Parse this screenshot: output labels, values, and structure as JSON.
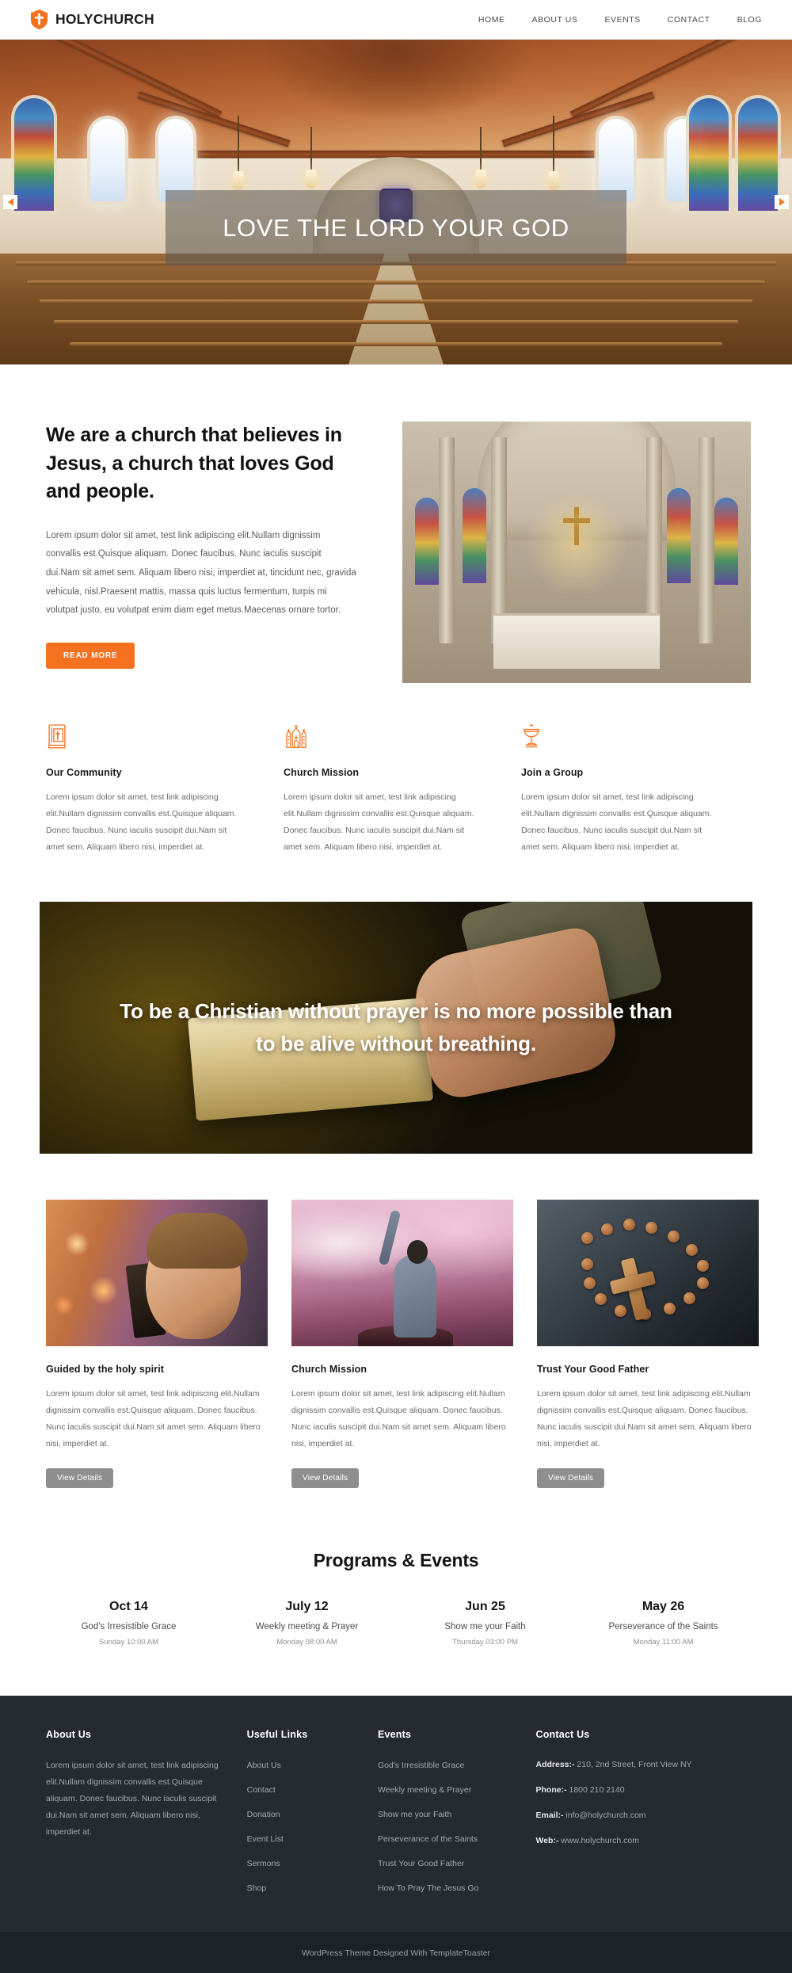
{
  "header": {
    "brand_name": "HOLYCHURCH",
    "logo_icon": "shield-cross-icon",
    "nav": [
      {
        "label": "HOME"
      },
      {
        "label": "ABOUT US"
      },
      {
        "label": "EVENTS"
      },
      {
        "label": "CONTACT"
      },
      {
        "label": "BLOG"
      }
    ]
  },
  "hero": {
    "headline": "LOVE THE LORD YOUR GOD",
    "prev_icon": "arrow-left-icon",
    "next_icon": "arrow-right-icon"
  },
  "about": {
    "heading": "We are a church that believes in Jesus, a church that loves God and people.",
    "body": "Lorem ipsum dolor sit amet, test link adipiscing elit.Nullam dignissim convallis est.Quisque aliquam. Donec faucibus. Nunc iaculis suscipit dui.Nam sit amet sem. Aliquam libero nisi, imperdiet at, tincidunt nec, gravida vehicula, nisl.Praesent mattis, massa quis luctus fermentum, turpis mi volutpat justo, eu volutpat enim diam eget metus.Maecenas ornare tortor.",
    "button_label": "READ MORE",
    "image_alt": "cathedral-interior-with-altar"
  },
  "features": [
    {
      "icon": "bible-cross-icon",
      "title": "Our Community",
      "text": "Lorem ipsum dolor sit amet, test link adipiscing elit.Nullam dignissim convallis est.Quisque aliquam. Donec faucibus. Nunc iaculis suscipit dui.Nam sit amet sem. Aliquam libero nisi, imperdiet at."
    },
    {
      "icon": "church-building-icon",
      "title": "Church Mission",
      "text": "Lorem ipsum dolor sit amet, test link adipiscing elit.Nullam dignissim convallis est.Quisque aliquam. Donec faucibus. Nunc iaculis suscipit dui.Nam sit amet sem. Aliquam libero nisi, imperdiet at."
    },
    {
      "icon": "chalice-icon",
      "title": "Join a Group",
      "text": "Lorem ipsum dolor sit amet, test link adipiscing elit.Nullam dignissim convallis est.Quisque aliquam. Donec faucibus. Nunc iaculis suscipit dui.Nam sit amet sem. Aliquam libero nisi, imperdiet at."
    }
  ],
  "quote": {
    "text": "To be a Christian without prayer is no more possible than to be alive without breathing.",
    "image_alt": "hands-resting-on-open-bible"
  },
  "cards": [
    {
      "image_alt": "boy-praying-with-bible-and-candles",
      "title": "Guided by the holy spirit",
      "text": "Lorem ipsum dolor sit amet, test link adipiscing elit.Nullam dignissim convallis est.Quisque aliquam. Donec faucibus. Nunc iaculis suscipit dui.Nam sit amet sem. Aliquam libero nisi, imperdiet at.",
      "button_label": "View Details"
    },
    {
      "image_alt": "person-raising-arm-on-mountain-at-sunset",
      "title": "Church Mission",
      "text": "Lorem ipsum dolor sit amet, test link adipiscing elit.Nullam dignissim convallis est.Quisque aliquam. Donec faucibus. Nunc iaculis suscipit dui.Nam sit amet sem. Aliquam libero nisi, imperdiet at.",
      "button_label": "View Details"
    },
    {
      "image_alt": "wooden-cross-with-rosary-beads",
      "title": "Trust Your Good Father",
      "text": "Lorem ipsum dolor sit amet, test link adipiscing elit.Nullam dignissim convallis est.Quisque aliquam. Donec faucibus. Nunc iaculis suscipit dui.Nam sit amet sem. Aliquam libero nisi, imperdiet at.",
      "button_label": "View Details"
    }
  ],
  "events_section": {
    "title": "Programs & Events",
    "items": [
      {
        "date": "Oct 14",
        "name": "God's Irresistible Grace",
        "time": "Sunday 10:00 AM"
      },
      {
        "date": "July 12",
        "name": "Weekly meeting & Prayer",
        "time": "Monday 08:00 AM"
      },
      {
        "date": "Jun 25",
        "name": "Show me your Faith",
        "time": "Thursday 03:00 PM"
      },
      {
        "date": "May 26",
        "name": "Perseverance of the Saints",
        "time": "Monday 11:00 AM"
      }
    ]
  },
  "footer": {
    "about": {
      "title": "About Us",
      "text": "Lorem ipsum dolor sit amet, test link adipiscing elit.Nullam dignissim convallis est.Quisque aliquam. Donec faucibus. Nunc iaculis suscipit dui.Nam sit amet sem. Aliquam libero nisi, imperdiet at."
    },
    "useful_links": {
      "title": "Useful Links",
      "items": [
        {
          "label": "About Us"
        },
        {
          "label": "Contact"
        },
        {
          "label": "Donation"
        },
        {
          "label": "Event List"
        },
        {
          "label": "Sermons"
        },
        {
          "label": "Shop"
        }
      ]
    },
    "events": {
      "title": "Events",
      "items": [
        {
          "label": "God's Irresistible Grace"
        },
        {
          "label": "Weekly meeting & Prayer"
        },
        {
          "label": "Show me your Faith"
        },
        {
          "label": "Perseverance of the Saints"
        },
        {
          "label": "Trust Your Good Father"
        },
        {
          "label": "How To Pray The Jesus Go"
        }
      ]
    },
    "contact": {
      "title": "Contact Us",
      "address_label": "Address:-",
      "address_value": "210, 2nd Street, Front View NY",
      "phone_label": "Phone:-",
      "phone_value": "1800 210 2140",
      "email_label": "Email:-",
      "email_value": "info@holychurch.com",
      "web_label": "Web:-",
      "web_value": "www.holychurch.com"
    },
    "copyright": "WordPress Theme Designed With TemplateToaster"
  },
  "colors": {
    "accent": "#f4711f",
    "footer_bg": "#262b31",
    "footer_bottom_bg": "#1d2227",
    "grey_button": "#8e8e8e"
  }
}
